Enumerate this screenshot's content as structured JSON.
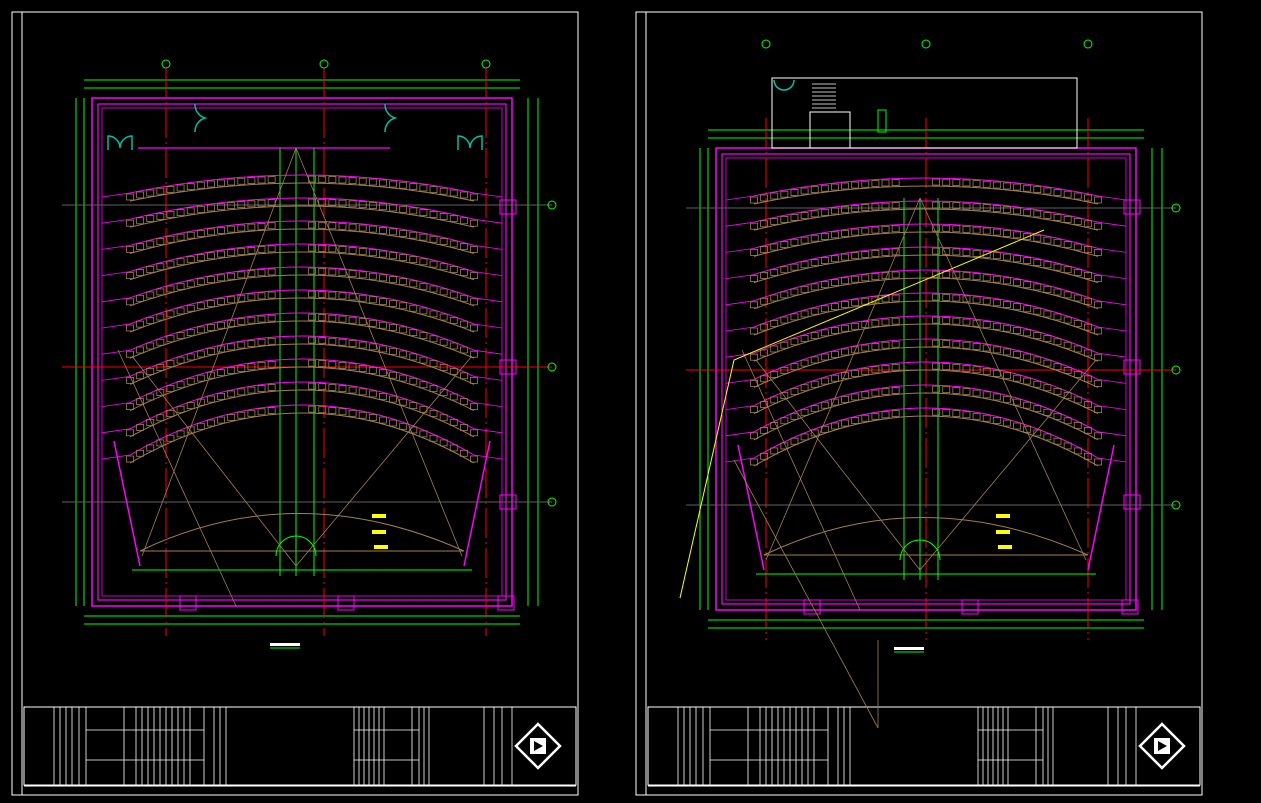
{
  "drawing": {
    "sheet_count": 2,
    "seat_rows": 11,
    "colors": {
      "background": "#000000",
      "frame": "#ffffff",
      "wall": "#ff00ff",
      "dimension": "#00ff00",
      "axis": "#ff0000",
      "seat": "#a08050",
      "door": "#00c0a0",
      "highlight": "#ffff00"
    }
  }
}
